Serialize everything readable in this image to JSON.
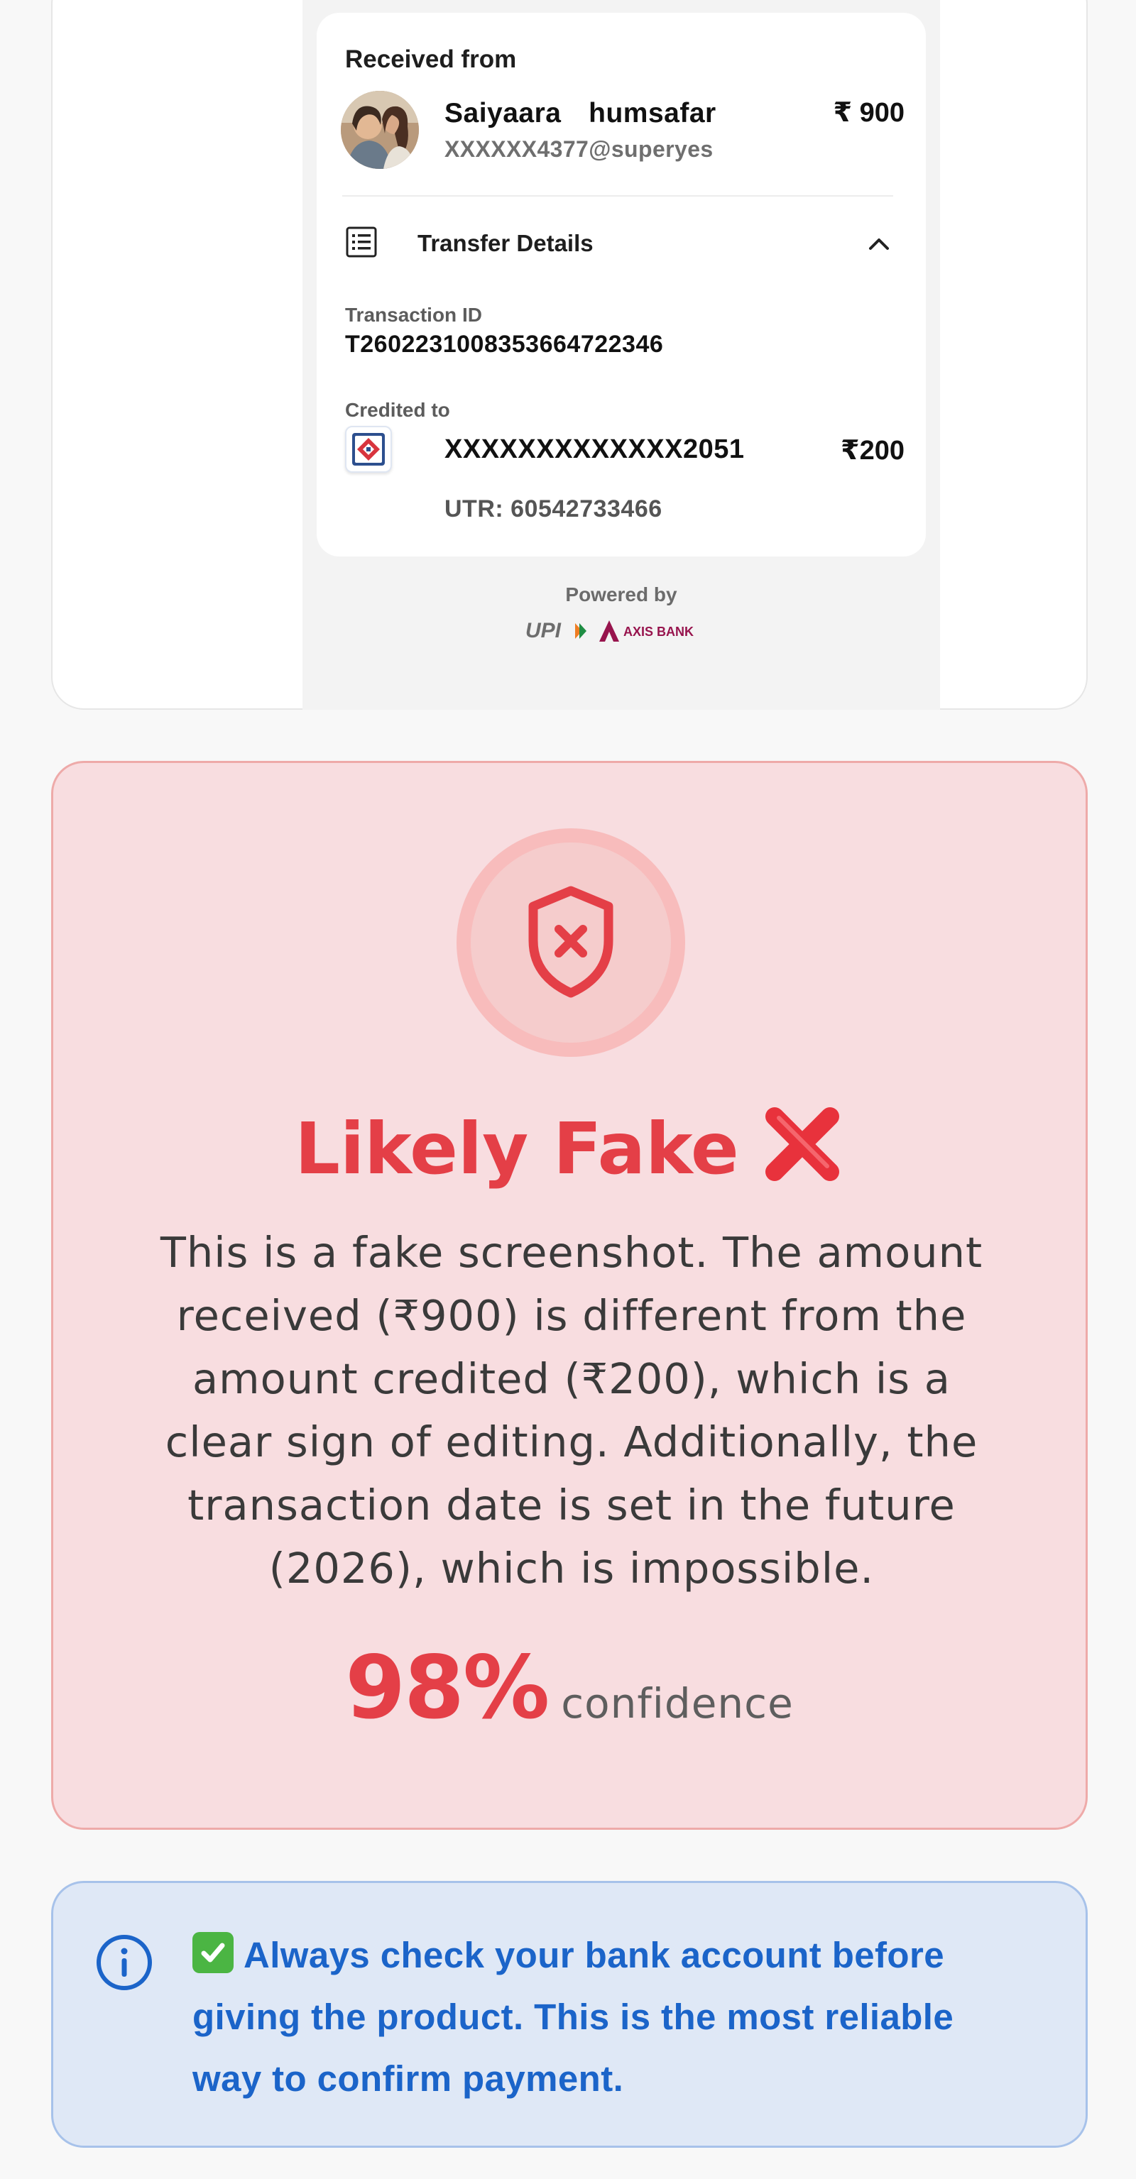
{
  "receipt": {
    "received_from_label": "Received from",
    "sender_name": "Saiyaara  humsafar",
    "sender_upi": "XXXXXX4377@superyes",
    "amount": "₹ 900",
    "transfer_details_label": "Transfer Details",
    "transaction_id_label": "Transaction ID",
    "transaction_id": "T2602231008353664722346",
    "credited_to_label": "Credited to",
    "account_number": "XXXXXXXXXXXXX2051",
    "credited_amount": "₹200",
    "utr": "UTR: 60542733466",
    "powered_by": "Powered by",
    "upi_logo_text": "UPI",
    "bank_logo_text": "AXIS BANK"
  },
  "verdict": {
    "title": "Likely Fake",
    "description": "This is a fake screenshot. The amount received (₹900) is different from the amount credited (₹200), which is a clear sign of editing. Additionally, the transaction date is set in the future (2026), which is impossible.",
    "confidence_value": "98%",
    "confidence_label": "confidence"
  },
  "tip": {
    "text": "Always check your bank account before giving the product. This is the most reliable way to confirm payment."
  },
  "colors": {
    "fake_red": "#e43f47",
    "verdict_bg": "#f8dde0",
    "tip_blue": "#1b64c9",
    "tip_bg": "#dfe8f6"
  },
  "icons": [
    "avatar-photo",
    "list-icon",
    "chevron-up-icon",
    "bank-logo-icon",
    "shield-x-icon",
    "red-x-icon",
    "info-icon",
    "check-mark-emoji"
  ]
}
